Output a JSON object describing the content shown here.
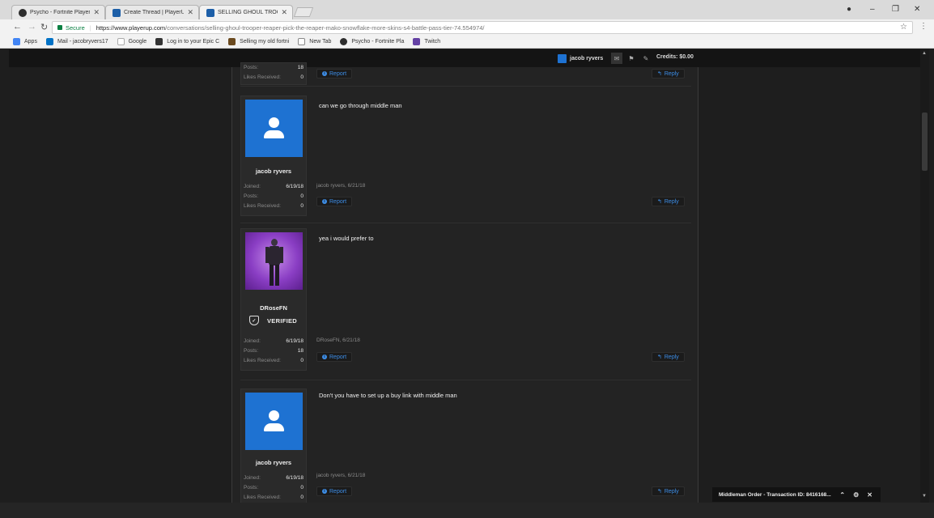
{
  "browser": {
    "tabs": [
      {
        "title": "Psycho - Fortnite Player S",
        "active": false
      },
      {
        "title": "Create Thread | PlayerUp",
        "active": false
      },
      {
        "title": "SELLING GHOUL TROOPE",
        "active": true
      }
    ],
    "url_host": "https://www.playerup.com",
    "url_path": "/conversations/selling-ghoul-trooper-reaper-pick-the-reaper-mako-snowflake-more-skins-s4-battle-pass-tier-74.554974/",
    "secure_label": "Secure",
    "bookmarks": [
      {
        "label": "Apps",
        "icon": "apps-grid-icon"
      },
      {
        "label": "Mail - jacobryvers17",
        "icon": "outlook-icon"
      },
      {
        "label": "Google",
        "icon": "google-icon"
      },
      {
        "label": "Log in to your Epic C",
        "icon": "epic-icon"
      },
      {
        "label": "Selling my old fortni",
        "icon": "bag-icon"
      },
      {
        "label": "New Tab",
        "icon": "page-icon"
      },
      {
        "label": "Psycho - Fortnite Pla",
        "icon": "psycho-icon"
      },
      {
        "label": "Twitch",
        "icon": "twitch-icon"
      }
    ]
  },
  "nav": {
    "user": "jacob ryvers",
    "credits": "Credits: $0.00"
  },
  "partial_post": {
    "posts_label": "Posts:",
    "posts_value": "18",
    "likes_label": "Likes Received:",
    "likes_value": "0",
    "report": "Report",
    "reply": "Reply"
  },
  "posts": [
    {
      "username": "jacob ryvers",
      "message": "can we go through middle man",
      "meta": "jacob ryvers, 6/21/18",
      "joined_label": "Joined:",
      "joined": "6/19/18",
      "posts_label": "Posts:",
      "posts": "0",
      "likes_label": "Likes Received:",
      "likes": "0",
      "report": "Report",
      "reply": "Reply"
    },
    {
      "username": "DRoseFN",
      "badge": "VERIFIED",
      "message": "yea i would prefer to",
      "meta": "DRoseFN, 6/21/18",
      "joined_label": "Joined:",
      "joined": "6/19/18",
      "posts_label": "Posts:",
      "posts": "18",
      "likes_label": "Likes Received:",
      "likes": "0",
      "report": "Report",
      "reply": "Reply"
    },
    {
      "username": "jacob ryvers",
      "message": "Don't you have to set up a buy link with middle man",
      "meta": "jacob ryvers, 6/21/18",
      "joined_label": "Joined:",
      "joined": "6/19/18",
      "posts_label": "Posts:",
      "posts": "0",
      "likes_label": "Likes Received:",
      "likes": "0",
      "report": "Report",
      "reply": "Reply"
    }
  ],
  "chat": {
    "title": "Middleman Order - Transaction ID: 8416168..."
  }
}
